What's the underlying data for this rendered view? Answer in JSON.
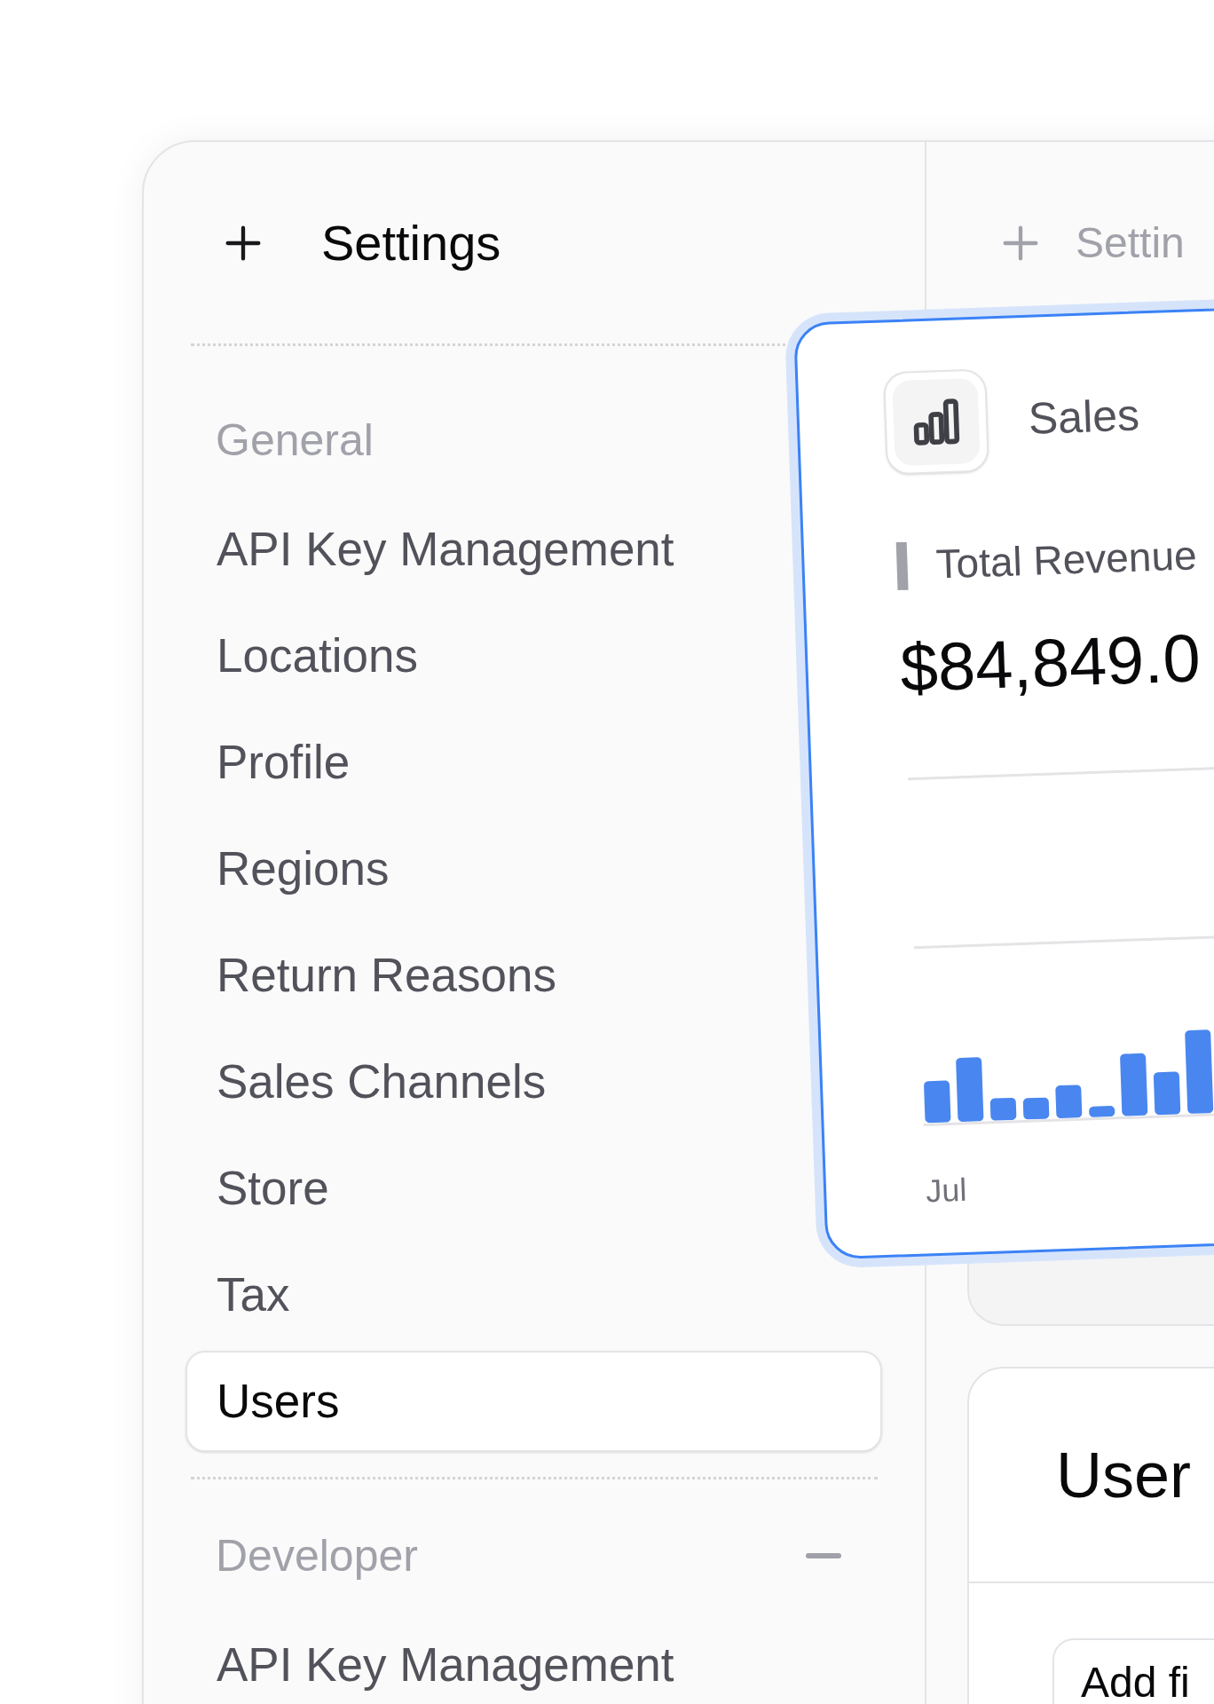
{
  "sidebar": {
    "title": "Settings",
    "sections": [
      {
        "label": "General",
        "items": [
          {
            "label": "API Key Management",
            "selected": false
          },
          {
            "label": "Locations",
            "selected": false
          },
          {
            "label": "Profile",
            "selected": false
          },
          {
            "label": "Regions",
            "selected": false
          },
          {
            "label": "Return Reasons",
            "selected": false
          },
          {
            "label": "Sales Channels",
            "selected": false
          },
          {
            "label": "Store",
            "selected": false
          },
          {
            "label": "Tax",
            "selected": false
          },
          {
            "label": "Users",
            "selected": true
          }
        ]
      },
      {
        "label": "Developer",
        "expanded": true,
        "items": [
          {
            "label": "API Key Management",
            "selected": false
          }
        ]
      }
    ]
  },
  "main": {
    "header": {
      "title": "Settin"
    },
    "users_card": {
      "title": "User",
      "button": "Add fi"
    }
  },
  "sales_card": {
    "title": "Sales",
    "metric_label": "Total Revenue",
    "metric_value": "$84,849.0",
    "axis_label": "Jul"
  }
}
